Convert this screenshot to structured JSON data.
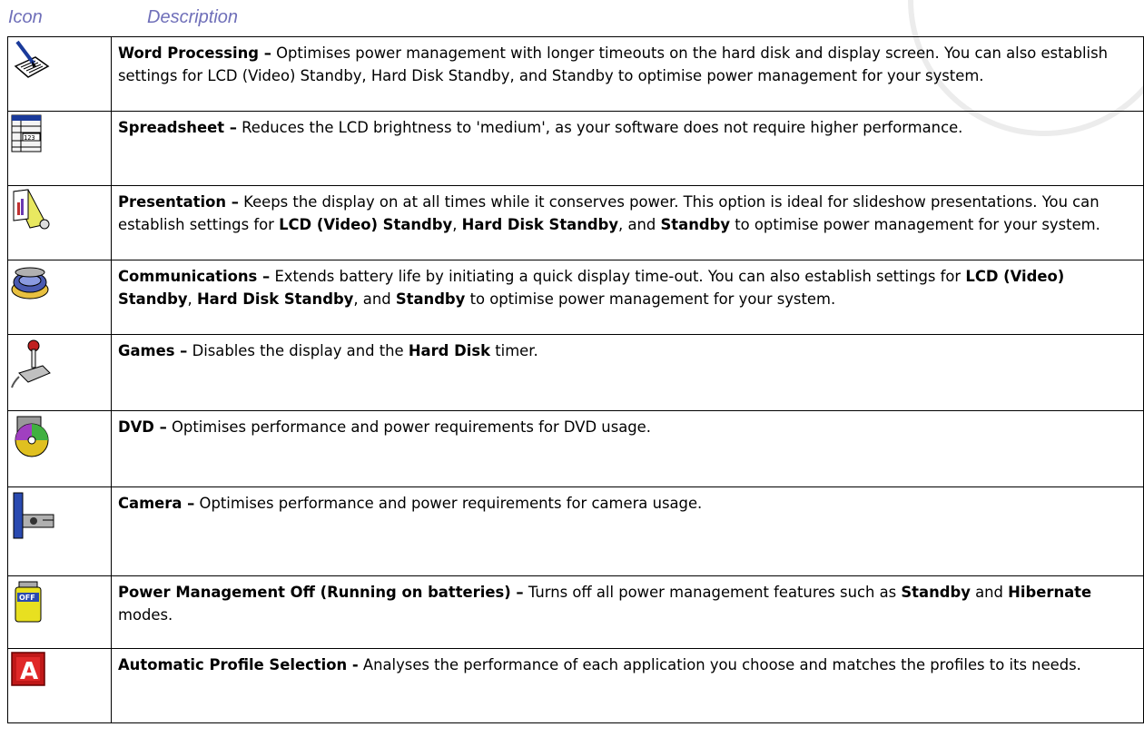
{
  "header": {
    "icon_col": "Icon",
    "desc_col": "Description"
  },
  "rows": [
    {
      "icon": "word-processing-icon",
      "title": "Word Processing –",
      "text": " Optimises power management with longer timeouts on the hard disk and display screen. You can also establish settings for LCD (Video) Standby, Hard Disk Standby, and Standby to optimise power management for your system."
    },
    {
      "icon": "spreadsheet-icon",
      "title": "Spreadsheet –",
      "text": " Reduces the LCD brightness to 'medium', as your software does not require higher performance."
    },
    {
      "icon": "presentation-icon",
      "title": "Presentation –",
      "text_a": " Keeps the display on at all times while it conserves power. This option is ideal for slideshow presentations. You can establish settings for ",
      "b1": "LCD (Video) Standby",
      "sep1": ", ",
      "b2": "Hard Disk Standby",
      "sep2": ", and ",
      "b3": "Standby",
      "text_b": " to optimise power management for your system."
    },
    {
      "icon": "communications-icon",
      "title": "Communications –",
      "text_a": " Extends battery life by initiating a quick display time-out. You can also establish settings for ",
      "b1": "LCD (Video) Standby",
      "sep1": ", ",
      "b2": "Hard Disk Standby",
      "sep2": ", and ",
      "b3": "Standby",
      "text_b": " to optimise power management for your system."
    },
    {
      "icon": "joystick-icon",
      "title": "Games –",
      "text_a": " Disables the display and the ",
      "b1": "Hard Disk",
      "text_b": " timer."
    },
    {
      "icon": "dvd-icon",
      "title": "DVD –",
      "text": " Optimises performance and power requirements for DVD usage."
    },
    {
      "icon": "camera-icon",
      "title": "Camera –",
      "text": " Optimises performance and power requirements for camera usage."
    },
    {
      "icon": "battery-off-icon",
      "title": "Power Management Off (Running on batteries) –",
      "text_a": " Turns off all power management features such as ",
      "b1": "Standby",
      "text_b": " and ",
      "b2": "Hibernate",
      "text_c": " modes."
    },
    {
      "icon": "automatic-profile-icon",
      "title": "Automatic Profile Selection -",
      "text": " Analyses the performance of each application you choose and matches the profiles to its needs.",
      "icon_letter": "A"
    }
  ]
}
